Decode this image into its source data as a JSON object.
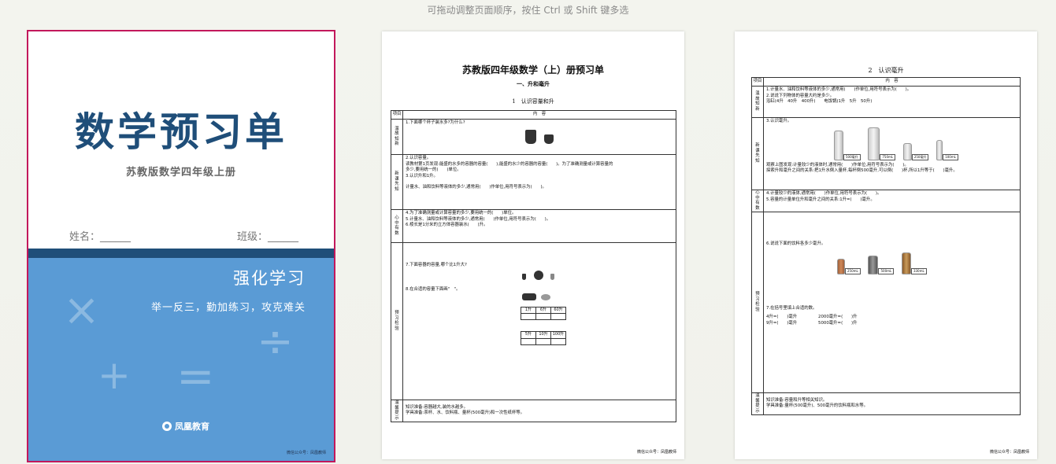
{
  "hint": "可拖动调整页面顺序，按住 Ctrl 或 Shift 键多选",
  "cover": {
    "title": "数学预习单",
    "subtitle": "苏教版数学四年级上册",
    "name_label": "姓名：______",
    "class_label": "班级：______",
    "strong_text": "强化学习",
    "slogan": "举一反三，勤加练习，攻克难关",
    "symbols": {
      "times": "×",
      "plus": "+",
      "equals": "=",
      "divide": "÷"
    },
    "logo_text": "凤凰教育",
    "wechat": "微信公众号：凤凰教师",
    "colors": {
      "navy": "#1f4e79",
      "blue": "#5a9bd5",
      "selection": "#c2185b"
    }
  },
  "page2": {
    "title": "苏教版四年级数学（上）册预习单",
    "section": "一、升和毫升",
    "lesson": "1　认识容量和升",
    "header_item": "项目",
    "header_content": "内　容",
    "rows": [
      {
        "cat": "温故知新",
        "lines": [
          "1.下面哪个杯子装水多?为什么?"
        ]
      },
      {
        "cat": "新课先知",
        "lines": [
          "2.认识容量。",
          "读教材第1页发现:能盛的水多的容器的容量(　　),能盛的水少的容器的容量(　　)。为了准确测量或计算容量的",
          "多少,要用统一的(　　)单位。",
          "3.认识升和1升。",
          "计量水、油和饮料等液体的多少,通常用(　　)作单位,用符号表示为(　　)。"
        ]
      },
      {
        "cat": "心中有数",
        "lines": [
          "4.为了准确测量或计算容量的多少,要用统一的(　　)单位。",
          "5.计量水、油和饮料等液体的多少,通常用(　　)作单位,用符号表示为(　　)。",
          "6.棱长是1分米的立方体容器装水(　　)升。"
        ]
      },
      {
        "cat": "预习检验",
        "lines": [
          "7.下面容器的容量,哪个比1升大?",
          "8.在合适的容量下面画\"　\"。"
        ]
      },
      {
        "cat": "温馨提示",
        "lines": [
          "知识准备:容器越大,装的水越多。",
          "学具准备:茶杯、水、饮料瓶、量杯(500毫升)和一次性纸杯等。"
        ]
      }
    ],
    "grid1": [
      "1升",
      "6升",
      "60升"
    ],
    "grid2": [
      "5升",
      "10升",
      "100升"
    ],
    "wechat": "微信公众号：凤凰教师"
  },
  "page3": {
    "title": "2　认识毫升",
    "header_item": "项目",
    "header_content": "内　容",
    "rows": [
      {
        "cat": "温故知新",
        "lines": [
          "1.计量水、油和饮料等液体的多少,通常用(　　)作单位,用符号表示为(　　)。",
          "2.说说下列物体的容量大约是多少。",
          "浴缸(4升　40升　400升)　　电饭锅(1升　5升　50升)"
        ]
      },
      {
        "cat": "新课先知",
        "lines": [
          "3.认识毫升。",
          "观察上图发现:计量较少的液体时,通常用(　　)作单位,用符号表示为(　　)。",
          "探索升和毫升之间的关系:把1升水倒入量杯,每杯倒500毫升,可以倒(　　)杯,所以1升等于(　　)毫升。"
        ]
      },
      {
        "cat": "心中有数",
        "lines": [
          "4.计量较少的液体,通常用(　　)作单位,用符号表示为(　　)。",
          "5.容量的计量单位升和毫升之间的关系:1升=(　　)毫升。"
        ]
      },
      {
        "cat": "预习检验",
        "lines": [
          "6.说说下面的饮料各多少毫升。",
          "7.在括号里填上合适的数。",
          "4升=(　　)毫升　　　　　2000毫升=(　　)升",
          "9升=(　　)毫升　　　　　5000毫升=(　　)升"
        ]
      },
      {
        "cat": "温馨提示",
        "lines": [
          "知识准备:容量和升等相关知识。",
          "学具准备:量杯(500毫升)、500毫升的饮料瓶和水等。"
        ]
      }
    ],
    "tags1": [
      "500毫升",
      "750mL",
      "250毫升",
      "100mL"
    ],
    "tags2": [
      "250mL",
      "500mL",
      "330mL"
    ],
    "wechat": "微信公众号：凤凰教师"
  }
}
